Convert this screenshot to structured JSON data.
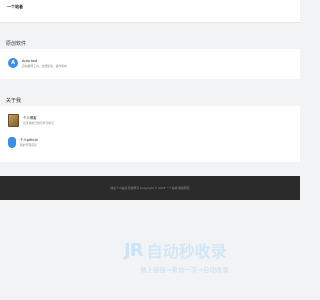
{
  "header": {
    "brand": "一个站者"
  },
  "sections": {
    "software_title": "原创软件",
    "about_title": "关于我"
  },
  "software": [
    {
      "icon": "app-icon",
      "glyph": "A",
      "title": "Auto tool",
      "desc": "自动翻译工具，免费使用，操作简单"
    }
  ],
  "about": [
    {
      "icon": "book-icon",
      "title": "个人博客",
      "desc": "记录我的日常与学习笔记"
    },
    {
      "icon": "shield-icon",
      "title": "个人github",
      "desc": "我的开源项目"
    }
  ],
  "footer": {
    "text": "博主个人站点·仅供学习 Copyright © 2023 一个站者 版权所有"
  },
  "watermark": {
    "logo": "JR",
    "title": "自动秒收录",
    "subtitle": "做上链接→来访一次→自动收录"
  }
}
